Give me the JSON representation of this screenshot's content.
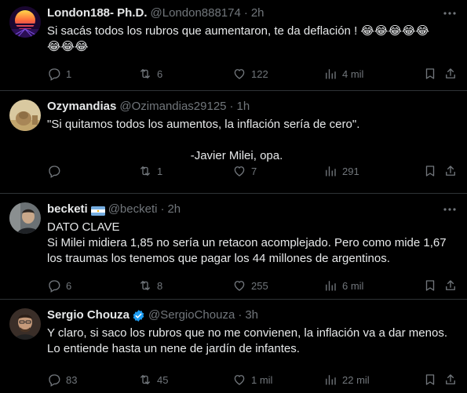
{
  "tweets": [
    {
      "name": "London188- Ph.D.",
      "handle": "@London888174",
      "time": "2h",
      "lines": [
        "Si sacás todos los rubros que aumentaron, te da deflación ! 😂😂😂😂😂",
        "😂😂😂"
      ],
      "replies": "1",
      "retweets": "6",
      "likes": "122",
      "views": "4 mil"
    },
    {
      "name": "Ozymandias",
      "handle": "@Ozimandias29125",
      "time": "1h",
      "lines": [
        "\"Si quitamos todos los aumentos, la inflación sería de cero\".",
        "-Javier Milei, opa."
      ],
      "replies": "",
      "retweets": "1",
      "likes": "7",
      "views": "291"
    },
    {
      "name": "becketi",
      "handle": "@becketi",
      "time": "2h",
      "lines": [
        "DATO CLAVE",
        "Si Milei midiera 1,85 no sería un retacon acomplejado. Pero como mide 1,67",
        "los traumas los tenemos que pagar los 44 millones de argentinos."
      ],
      "replies": "6",
      "retweets": "8",
      "likes": "255",
      "views": "6 mil"
    },
    {
      "name": "Sergio Chouza",
      "handle": "@SergioChouza",
      "time": "3h",
      "lines": [
        "Y claro, si saco los rubros que no me convienen, la inflación va a dar menos.",
        "Lo entiende hasta un nene de jardín de infantes."
      ],
      "replies": "83",
      "retweets": "45",
      "likes": "1 mil",
      "views": "22 mil"
    }
  ],
  "separator": "·",
  "colors": {
    "background": "#000000",
    "text": "#e7e9ea",
    "muted": "#71767b",
    "border": "#2f3336",
    "verified": "#1d9bf0"
  }
}
